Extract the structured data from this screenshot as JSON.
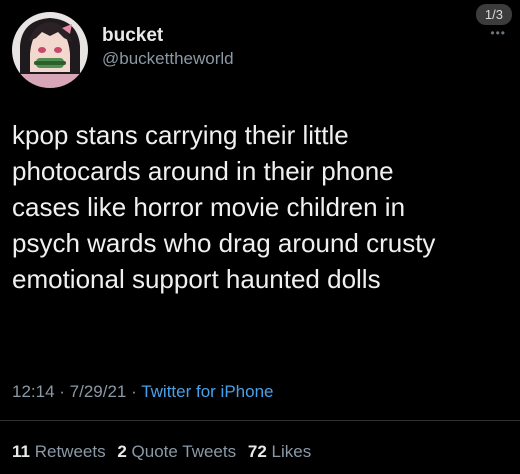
{
  "pager": {
    "label": "1/3"
  },
  "more_icon": "more-icon",
  "user": {
    "display_name": "bucket",
    "handle": "@buckettheworld"
  },
  "tweet": {
    "lines": [
      "kpop stans carrying their little",
      "photocards around in their phone",
      "cases like horror movie children in",
      "psych wards who drag around crusty",
      "emotional support haunted dolls"
    ]
  },
  "meta": {
    "time": "12:14",
    "sep1": " · ",
    "date": "7/29/21",
    "sep2": " · ",
    "source": "Twitter for iPhone"
  },
  "stats": {
    "retweets_count": "11",
    "retweets_label": "Retweets",
    "quotes_count": "2",
    "quotes_label": "Quote Tweets",
    "likes_count": "72",
    "likes_label": "Likes"
  }
}
